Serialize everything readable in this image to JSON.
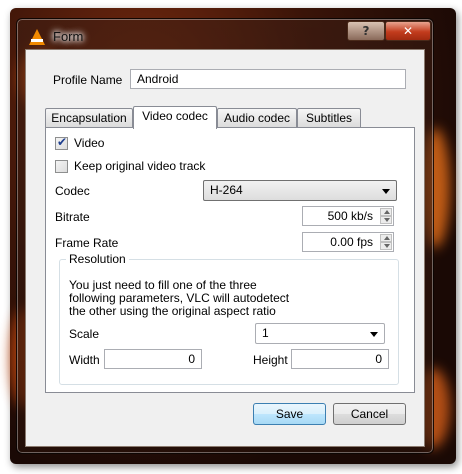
{
  "window": {
    "title": "Form",
    "help_label": "?",
    "close_label": "✕"
  },
  "profile": {
    "label": "Profile Name",
    "value": "Android"
  },
  "tabs": [
    {
      "label": "Encapsulation",
      "active": false
    },
    {
      "label": "Video codec",
      "active": true
    },
    {
      "label": "Audio codec",
      "active": false
    },
    {
      "label": "Subtitles",
      "active": false
    }
  ],
  "video_codec": {
    "video_checkbox": {
      "label": "Video",
      "checked": true
    },
    "keep_original": {
      "label": "Keep original video track",
      "checked": false
    },
    "codec": {
      "label": "Codec",
      "value": "H-264"
    },
    "bitrate": {
      "label": "Bitrate",
      "value": "500 kb/s"
    },
    "frame_rate": {
      "label": "Frame Rate",
      "value": "0.00 fps"
    },
    "resolution": {
      "title": "Resolution",
      "hint_line1": "You just need to fill one of the three",
      "hint_line2": "following parameters, VLC will autodetect",
      "hint_line3": "the other using the original aspect ratio",
      "scale_label": "Scale",
      "scale_value": "1",
      "width_label": "Width",
      "width_value": "0",
      "height_label": "Height",
      "height_value": "0"
    }
  },
  "buttons": {
    "save": "Save",
    "cancel": "Cancel"
  },
  "colors": {
    "accent": "#3c7fb1",
    "vlc_orange": "#f28a00",
    "close_red": "#c33c1d"
  }
}
